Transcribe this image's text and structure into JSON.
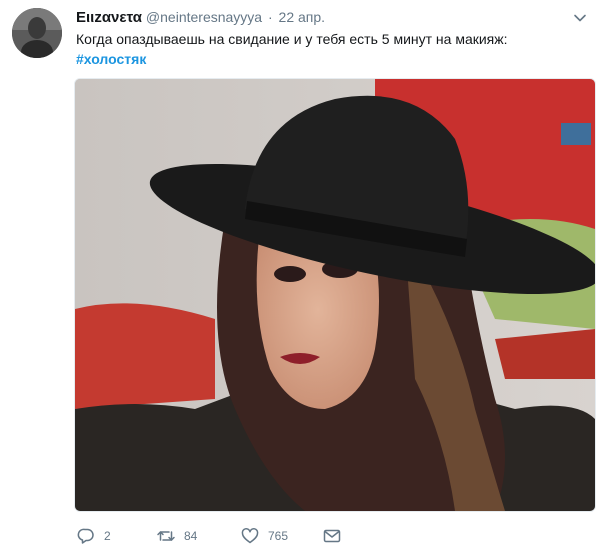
{
  "tweet": {
    "author_name": "Ειιzανετα",
    "handle": "@neinteresnayyya",
    "dot": "·",
    "date": "22 апр.",
    "text": "Когда опаздываешь на свидание и у тебя есть 5 минут на макияж:",
    "hashtag": "#холостяк"
  },
  "actions": {
    "reply_count": "2",
    "retweet_count": "84",
    "like_count": "765"
  },
  "icons": {
    "caret": "chevron-down-icon",
    "reply": "reply-icon",
    "retweet": "retweet-icon",
    "like": "heart-icon",
    "dm": "envelope-icon"
  },
  "colors": {
    "link": "#1b95e0",
    "secondary_text": "#657786",
    "primary_text": "#14171a"
  }
}
